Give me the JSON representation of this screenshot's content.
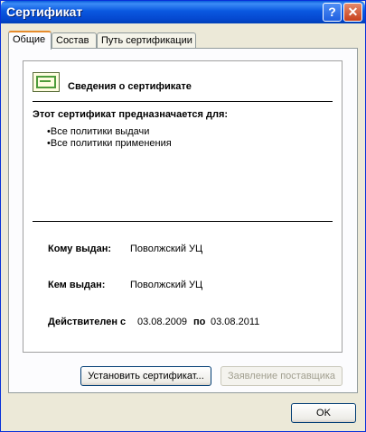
{
  "window": {
    "title": "Сертификат",
    "help_glyph": "?",
    "close_glyph": "✕"
  },
  "tabs": [
    {
      "label": "Общие",
      "active": true
    },
    {
      "label": "Состав",
      "active": false
    },
    {
      "label": "Путь сертификации",
      "active": false
    }
  ],
  "general": {
    "header_title": "Сведения о сертификате",
    "purpose_heading": "Этот сертификат предназначается для:",
    "purposes": [
      "•Все политики выдачи",
      "•Все политики применения"
    ],
    "issued_to_label": "Кому выдан:",
    "issued_to_value": "Поволжский УЦ",
    "issued_by_label": "Кем выдан:",
    "issued_by_value": "Поволжский УЦ",
    "valid_from_label": "Действителен с",
    "valid_from_value": "03.08.2009",
    "valid_to_label": "по",
    "valid_to_value": "03.08.2011"
  },
  "buttons": {
    "install_label": "Установить сертификат...",
    "issuer_statement_label": "Заявление поставщика",
    "ok_label": "OK"
  }
}
